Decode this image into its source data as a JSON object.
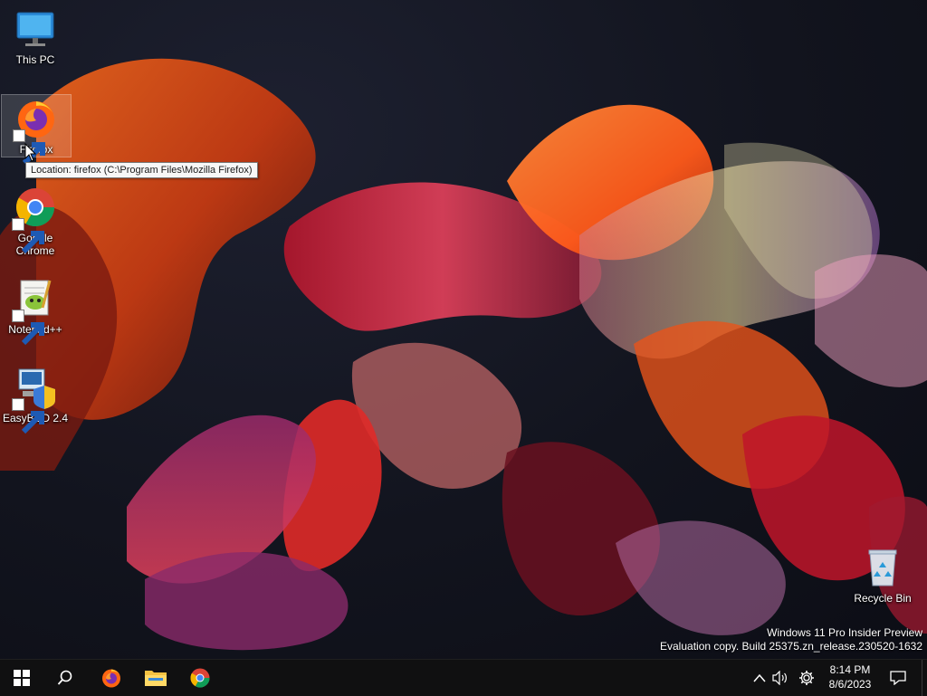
{
  "desktop": {
    "icons": [
      {
        "label": "This PC",
        "icon": "monitor-icon"
      },
      {
        "label": "Firefox",
        "icon": "firefox-icon"
      },
      {
        "label": "Google Chrome",
        "icon": "chrome-icon"
      },
      {
        "label": "Notepad++",
        "icon": "notepadpp-icon"
      },
      {
        "label": "EasyBCD 2.4",
        "icon": "easybcd-icon"
      },
      {
        "label": "Recycle Bin",
        "icon": "recycle-bin-icon"
      }
    ],
    "tooltip": "Location: firefox (C:\\Program Files\\Mozilla Firefox)",
    "watermark": {
      "line1": "Windows 11 Pro Insider Preview",
      "line2": "Evaluation copy. Build 25375.zn_release.230520-1632"
    }
  },
  "taskbar": {
    "buttons": [
      "start-icon",
      "search-icon",
      "firefox-icon",
      "file-explorer-icon",
      "chrome-icon"
    ],
    "tray": [
      "chevron-up-icon",
      "volume-icon",
      "settings-icon",
      "notification-icon"
    ],
    "clock": {
      "time": "8:14 PM",
      "date": "8/6/2023"
    }
  },
  "colors": {
    "taskbar": "#101011",
    "tooltip_bg": "#f7f7f7",
    "text": "#ffffff"
  }
}
